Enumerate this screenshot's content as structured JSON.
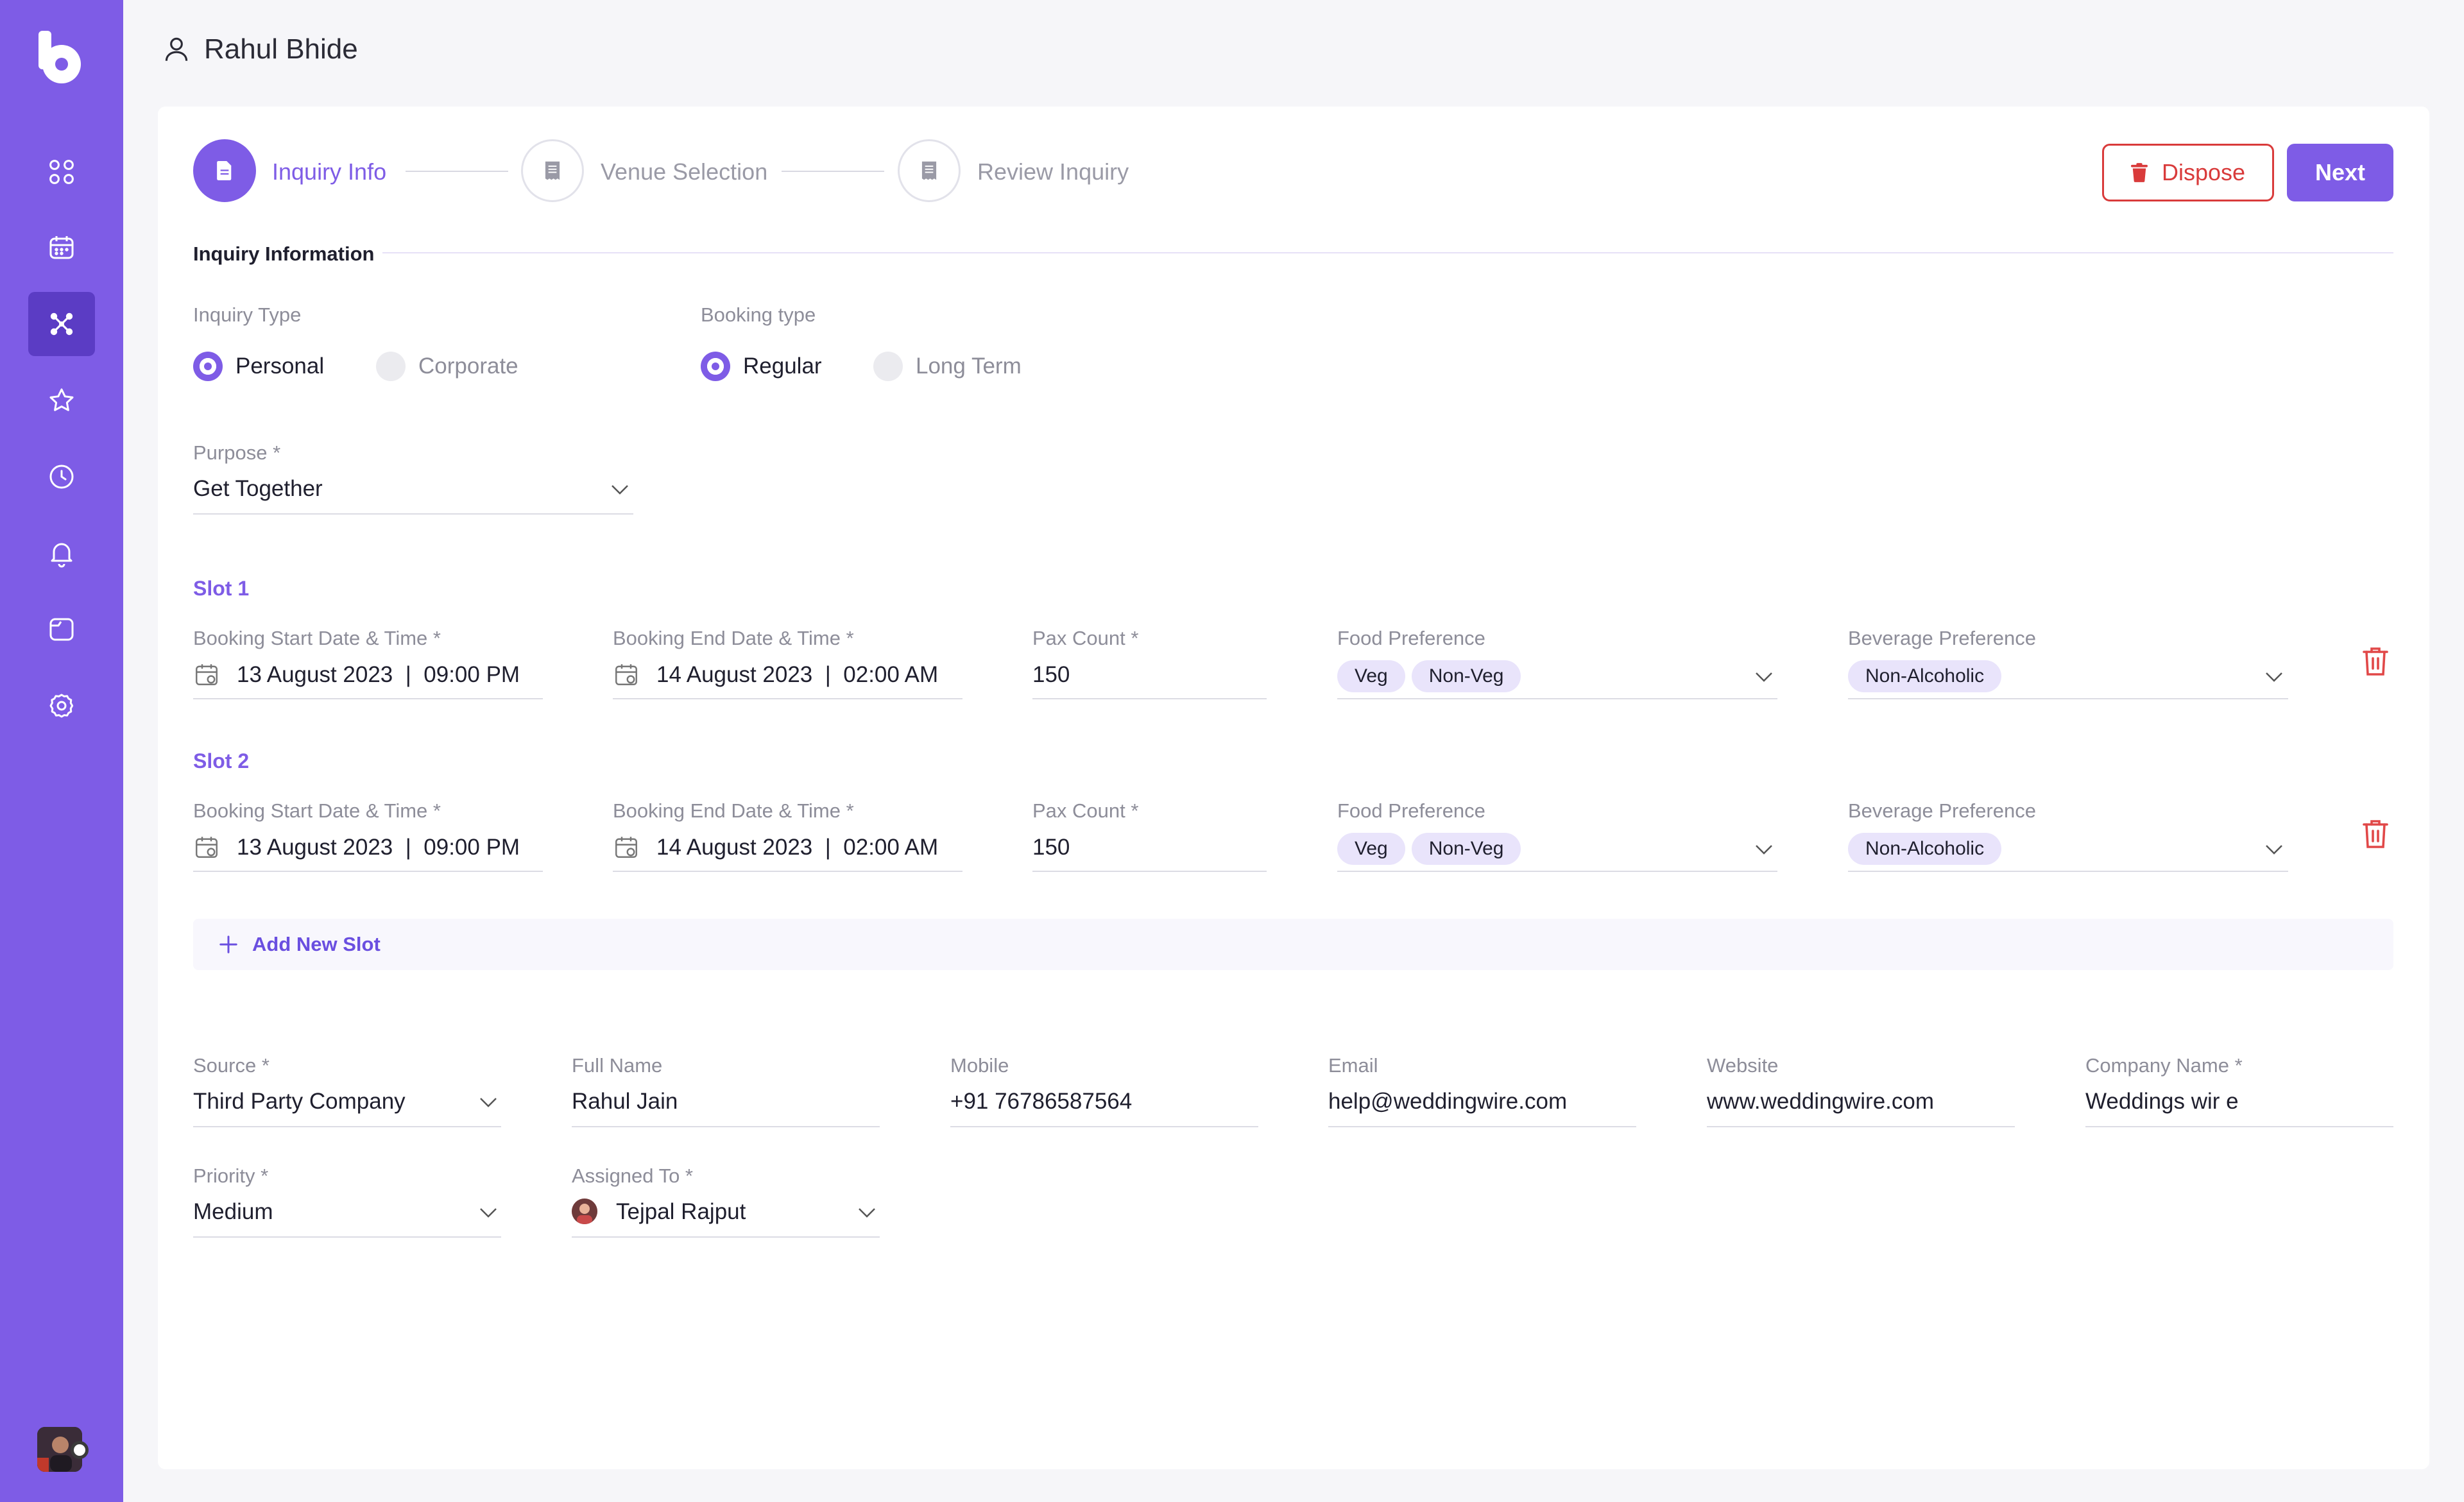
{
  "header": {
    "user_name": "Rahul Bhide"
  },
  "sidebar": {
    "items": [
      {
        "icon": "dashboard-icon"
      },
      {
        "icon": "calendar-icon"
      },
      {
        "icon": "inquiries-icon",
        "active": true
      },
      {
        "icon": "star-icon"
      },
      {
        "icon": "clock-icon"
      },
      {
        "icon": "bell-icon"
      },
      {
        "icon": "folder-icon"
      },
      {
        "icon": "gear-icon"
      }
    ]
  },
  "stepper": {
    "steps": [
      {
        "label": "Inquiry Info",
        "active": true
      },
      {
        "label": "Venue Selection",
        "active": false
      },
      {
        "label": "Review Inquiry",
        "active": false
      }
    ]
  },
  "actions": {
    "dispose_label": "Dispose",
    "next_label": "Next"
  },
  "inquiry": {
    "section_title": "Inquiry Information",
    "inquiry_type": {
      "label": "Inquiry Type",
      "options": [
        "Personal",
        "Corporate"
      ],
      "selected": "Personal"
    },
    "booking_type": {
      "label": "Booking type",
      "options": [
        "Regular",
        "Long Term"
      ],
      "selected": "Regular"
    },
    "purpose": {
      "label": "Purpose *",
      "value": "Get Together"
    }
  },
  "slot_labels": {
    "start": "Booking Start Date & Time *",
    "end": "Booking End Date & Time *",
    "pax": "Pax Count *",
    "food": "Food Preference",
    "beverage": "Beverage Preference"
  },
  "slots": [
    {
      "title": "Slot 1",
      "start": "13 August 2023  |  09:00 PM",
      "end": "14 August 2023  |  02:00 AM",
      "pax": "150",
      "food": [
        "Veg",
        "Non-Veg"
      ],
      "beverage": [
        "Non-Alcoholic"
      ]
    },
    {
      "title": "Slot 2",
      "start": "13 August 2023  |  09:00 PM",
      "end": "14 August 2023  |  02:00 AM",
      "pax": "150",
      "food": [
        "Veg",
        "Non-Veg"
      ],
      "beverage": [
        "Non-Alcoholic"
      ]
    }
  ],
  "add_slot_label": "Add New Slot",
  "contact": {
    "source": {
      "label": "Source *",
      "value": "Third Party Company"
    },
    "full_name": {
      "label": "Full Name",
      "value": "Rahul Jain"
    },
    "mobile": {
      "label": "Mobile",
      "value": "+91 76786587564"
    },
    "email": {
      "label": "Email",
      "value": "help@weddingwire.com"
    },
    "website": {
      "label": "Website",
      "value": "www.weddingwire.com"
    },
    "company": {
      "label": "Company Name *",
      "value": "Weddings wir e"
    },
    "priority": {
      "label": "Priority *",
      "value": "Medium"
    },
    "assigned_to": {
      "label": "Assigned To *",
      "value": "Tejpal Rajput"
    }
  },
  "colors": {
    "accent": "#7e5ce6",
    "danger": "#d93b3b",
    "sidebar": "#7e5ce6"
  }
}
